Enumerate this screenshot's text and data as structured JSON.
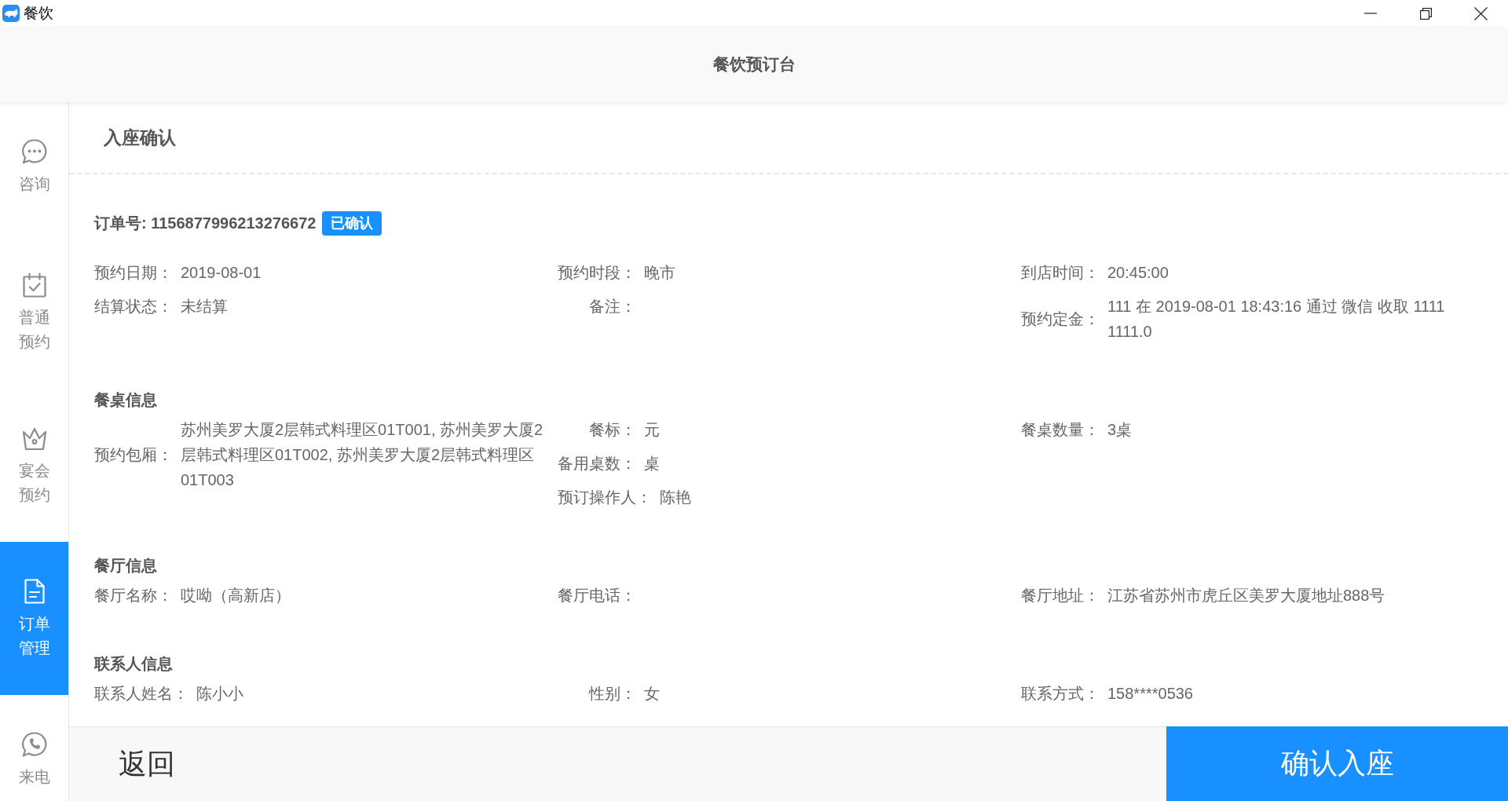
{
  "title_bar": {
    "title": "餐饮"
  },
  "header": {
    "title": "餐饮预订台"
  },
  "sidebar": {
    "items": [
      {
        "label": "咨询",
        "selected": false
      },
      {
        "label": "普通预约",
        "selected": false
      },
      {
        "label": "宴会预约",
        "selected": false
      },
      {
        "label": "订单管理",
        "selected": true
      },
      {
        "label": "来电",
        "selected": false
      }
    ]
  },
  "page": {
    "title": "入座确认",
    "order": {
      "number": "订单号: 1156877996213276672",
      "status": "已确认"
    },
    "sections": [
      {
        "columns": [
          [
            {
              "label": "预约日期：",
              "value": "2019-08-01"
            },
            {
              "label": "结算状态：",
              "value": "未结算"
            }
          ],
          [
            {
              "label": "预约时段：",
              "value": "晚市"
            },
            {
              "label": "备注："
            }
          ],
          [
            {
              "label": "到店时间：",
              "value": "20:45:00"
            },
            {
              "label": "预约定金：",
              "value": "111 在 2019-08-01 18:43:16 通过 微信 收取 1111 1111.0"
            }
          ]
        ]
      },
      {
        "heading": "餐桌信息",
        "columns": [
          [
            {
              "label": "预约包厢：",
              "value": "苏州美罗大厦2层韩式料理区01T001, 苏州美罗大厦2层韩式料理区01T002, 苏州美罗大厦2层韩式料理区01T003"
            }
          ],
          [
            {
              "label": "餐标：",
              "value": "元"
            },
            {
              "label": "备用桌数：",
              "value": "桌"
            },
            {
              "label": "预订操作人：",
              "value": "陈艳"
            }
          ],
          [
            {
              "label": "餐桌数量：",
              "value": "3桌"
            }
          ]
        ]
      },
      {
        "heading": "餐厅信息",
        "columns": [
          [
            {
              "label": "餐厅名称：",
              "value": "哎呦（高新店）"
            }
          ],
          [
            {
              "label": "餐厅电话："
            }
          ],
          [
            {
              "label": "餐厅地址：",
              "value": "江苏省苏州市虎丘区美罗大厦地址888号"
            }
          ]
        ]
      },
      {
        "heading": "联系人信息",
        "columns": [
          [
            {
              "label": "联系人姓名：",
              "value": "陈小小"
            }
          ],
          [
            {
              "label": "性别：",
              "value": "女"
            }
          ],
          [
            {
              "label": "联系方式：",
              "value": "158****0536"
            }
          ]
        ]
      }
    ]
  },
  "footer": {
    "back": "返回",
    "confirm": "确认入座"
  }
}
